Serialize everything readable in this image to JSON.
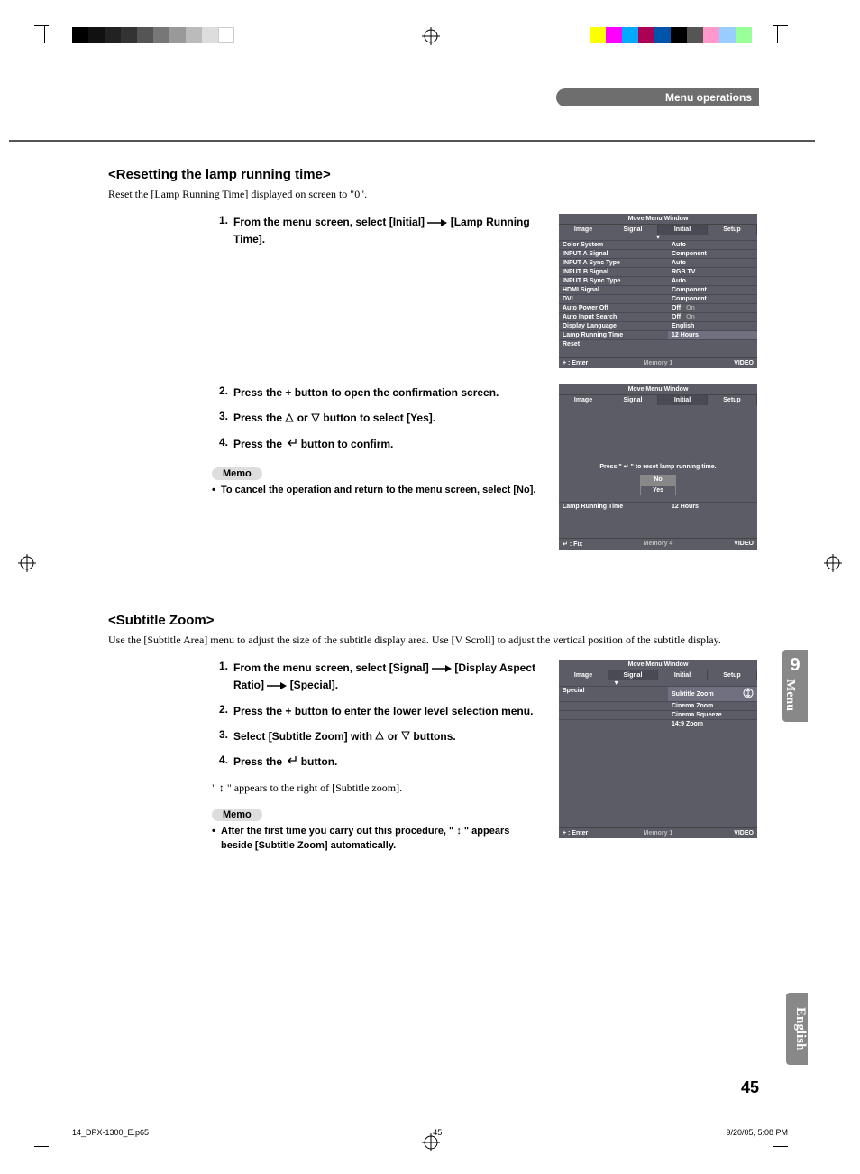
{
  "header": {
    "section": "Menu operations"
  },
  "sideTab": {
    "number": "9",
    "label": "Menu",
    "language": "English"
  },
  "pageNumber": "45",
  "footer": {
    "file": "14_DPX-1300_E.p65",
    "page": "45",
    "date": "9/20/05, 5:08 PM"
  },
  "section1": {
    "title": "<Resetting the lamp running time>",
    "intro": "Reset the [Lamp Running Time] displayed on screen to \"0\".",
    "steps": {
      "s1a": "From the menu screen, select [Initial] ",
      "s1b": " [Lamp Running Time].",
      "s2": "Press the + button to open the confirmation screen.",
      "s3a": "Press the ",
      "s3b": " or ",
      "s3c": " button to select [Yes].",
      "s4a": "Press the ",
      "s4b": " button to confirm."
    },
    "memo": "Memo",
    "memoNote": "To cancel the operation and return to the menu screen, select [No]."
  },
  "osd1": {
    "title": "Move Menu Window",
    "tabs": [
      "Image",
      "Signal",
      "Initial",
      "Setup"
    ],
    "rows": [
      {
        "l": "Color System",
        "r": "Auto"
      },
      {
        "l": "INPUT A Signal",
        "r": "Component"
      },
      {
        "l": "INPUT A Sync Type",
        "r": "Auto"
      },
      {
        "l": "INPUT B Signal",
        "r": "RGB TV"
      },
      {
        "l": "INPUT B Sync Type",
        "r": "Auto"
      },
      {
        "l": "HDMI Signal",
        "r": "Component"
      },
      {
        "l": "DVI",
        "r": "Component"
      },
      {
        "l": "Auto Power Off",
        "r": "Off",
        "r2": "On"
      },
      {
        "l": "Auto Input Search",
        "r": "Off",
        "r2": "On"
      },
      {
        "l": "Display Language",
        "r": "English"
      },
      {
        "l": "Lamp Running Time",
        "r": "12 Hours",
        "hl": true
      },
      {
        "l": "Reset",
        "r": ""
      }
    ],
    "foot": {
      "l": "+ : Enter",
      "m": "Memory 1",
      "r": "VIDEO"
    }
  },
  "osd2": {
    "title": "Move Menu Window",
    "tabs": [
      "Image",
      "Signal",
      "Initial",
      "Setup"
    ],
    "msg": "Press  \" ↵ \"  to reset lamp running time.",
    "opts": [
      "No",
      "Yes"
    ],
    "row": {
      "l": "Lamp Running Time",
      "r": "12 Hours"
    },
    "foot": {
      "l": "↵ : Fix",
      "m": "Memory 4",
      "r": "VIDEO"
    }
  },
  "section2": {
    "title": "<Subtitle Zoom>",
    "intro": "Use the [Subtitle Area] menu to adjust the size of the subtitle display area. Use [V Scroll] to adjust the vertical position of the subtitle display.",
    "steps": {
      "s1a": "From the menu screen, select [Signal] ",
      "s1b": " [Display Aspect Ratio] ",
      "s1c": " [Special].",
      "s2": "Press the + button to enter the lower level selection menu.",
      "s3a": "Select [Subtitle Zoom] with ",
      "s3b": " or ",
      "s3c": " buttons.",
      "s4a": "Press the ",
      "s4b": " button.",
      "note": "\" ↕ \" appears to the right of [Subtitle zoom]."
    },
    "memo": "Memo",
    "memoNote": "After the first time you carry out this procedure, \" ↕ \" appears beside [Subtitle Zoom] automatically."
  },
  "osd3": {
    "title": "Move Menu Window",
    "tabs": [
      "Image",
      "Signal",
      "Initial",
      "Setup"
    ],
    "rows": [
      {
        "l": "Special",
        "r": "Subtitle Zoom",
        "hl": true,
        "icon": true
      },
      {
        "l": "",
        "r": "Cinema Zoom"
      },
      {
        "l": "",
        "r": "Cinema Squeeze"
      },
      {
        "l": "",
        "r": "14:9 Zoom"
      }
    ],
    "foot": {
      "l": "+ : Enter",
      "m": "Memory 1",
      "r": "VIDEO"
    }
  }
}
